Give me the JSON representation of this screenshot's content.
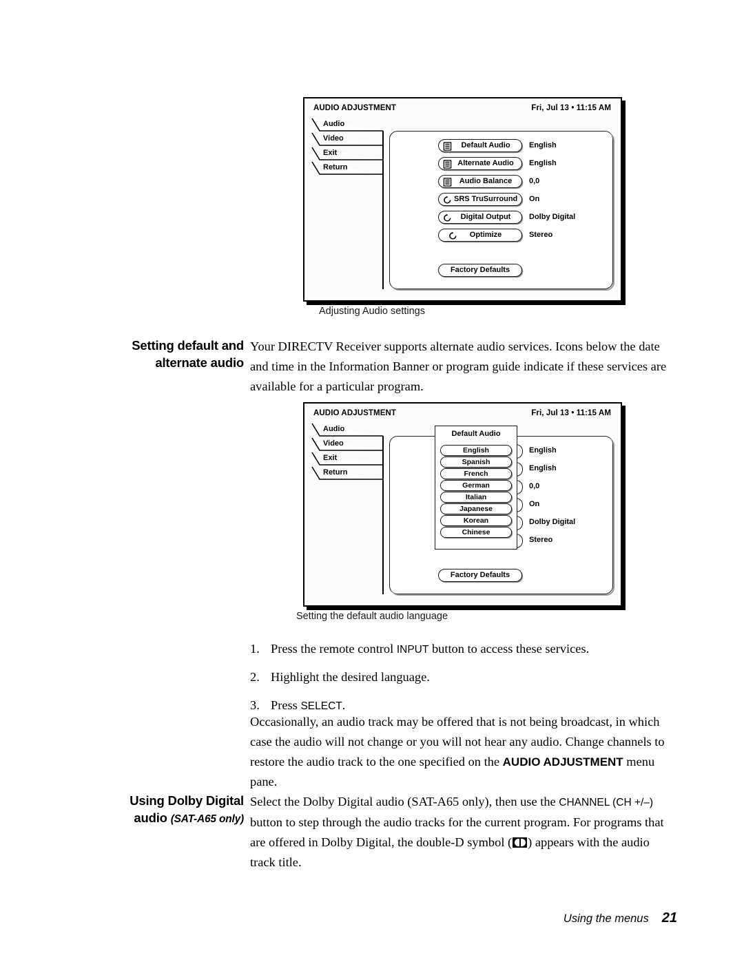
{
  "figure1": {
    "title": "AUDIO ADJUSTMENT",
    "datetime": "Fri, Jul 13  • 11:15 AM",
    "tabs": [
      "Audio",
      "Video",
      "Exit",
      "Return"
    ],
    "rows": [
      {
        "icon": "list-icon",
        "label": "Default Audio",
        "value": "English"
      },
      {
        "icon": "list-icon",
        "label": "Alternate Audio",
        "value": "English"
      },
      {
        "icon": "list-icon",
        "label": "Audio Balance",
        "value": "0,0"
      },
      {
        "icon": "cycle-icon",
        "label": "SRS TruSurround",
        "value": "On"
      },
      {
        "icon": "cycle-icon",
        "label": "Digital Output",
        "value": "Dolby Digital"
      },
      {
        "icon": "cycle-icon",
        "label": "Optimize",
        "value": "Stereo"
      }
    ],
    "factory_defaults": "Factory Defaults",
    "caption": "Adjusting Audio settings"
  },
  "figure2": {
    "title": "AUDIO ADJUSTMENT",
    "datetime": "Fri, Jul 13  • 11:15 AM",
    "tabs": [
      "Audio",
      "Video",
      "Exit",
      "Return"
    ],
    "dropdown": {
      "title": "Default Audio",
      "options": [
        "English",
        "Spanish",
        "French",
        "German",
        "Italian",
        "Japanese",
        "Korean",
        "Chinese"
      ]
    },
    "values": [
      "English",
      "English",
      "0,0",
      "On",
      "Dolby Digital",
      "Stereo"
    ],
    "factory_defaults": "Factory Defaults",
    "caption": "Setting the default audio language"
  },
  "section1": {
    "heading_line1": "Setting default and",
    "heading_line2": "alternate audio",
    "paragraph": "Your DIRECTV Receiver supports alternate audio services. Icons below the date and time in the Information Banner or program guide indicate if these services are available for a particular program."
  },
  "steps": [
    {
      "num": "1.",
      "pre": "Press the remote control ",
      "key": "INPUT",
      "post": " button to access these services."
    },
    {
      "num": "2.",
      "pre": "Highlight the desired language.",
      "key": "",
      "post": ""
    },
    {
      "num": "3.",
      "pre": "Press ",
      "key": "SELECT",
      "post": "."
    }
  ],
  "note_paragraph": {
    "part1": "Occasionally, an audio track may be offered that is not being broadcast, in which case the audio will not change or you will not hear any audio. Change channels to restore the audio track to the one specified on the ",
    "bold": "AUDIO ADJUSTMENT",
    "part2": " menu pane."
  },
  "section2": {
    "heading_line1": "Using Dolby Digital",
    "heading_line2_bold": "audio",
    "heading_line2_note": "(SAT-A65 only)",
    "p_part1": "Select the Dolby Digital audio (SAT-A65 only), then use the ",
    "p_key": "CHANNEL (CH +/–)",
    "p_part2": " button to step through the audio tracks for the current program. For programs that are offered in Dolby Digital, the double-D symbol (",
    "p_part3": ") appears with the audio track title."
  },
  "footer": {
    "label": "Using the menus",
    "page": "21"
  }
}
